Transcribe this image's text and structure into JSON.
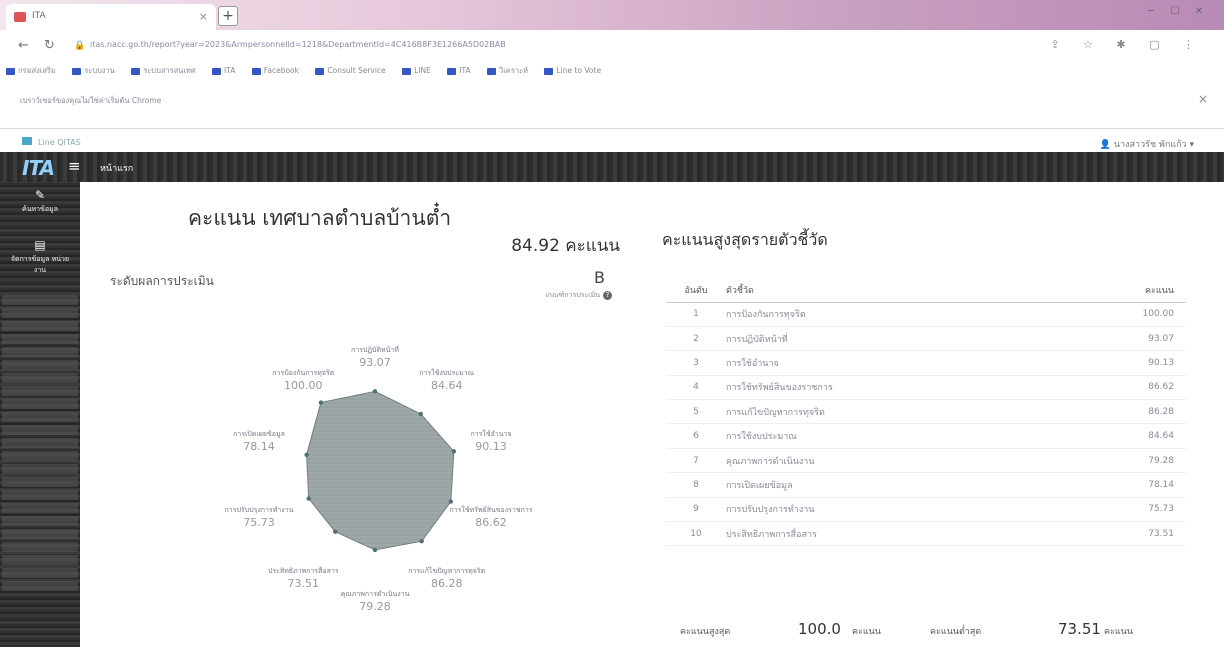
{
  "browser": {
    "tab_title": "ITA",
    "tab_close": "×",
    "new_tab": "+",
    "url": "itas.nacc.go.th/report?year=2023&ArmpersonnelId=1218&DepartmentId=4C416B8F3E1266A5D02BAB",
    "bookmarks": [
      "กรมส่งเสริม",
      "ระบบงาน",
      "ระบบสารสนเทศ",
      "ITA",
      "Facebook",
      "Consult Service",
      "LINE",
      "ITA",
      "วิเคราะห์",
      "Line to Vote"
    ],
    "notice": "เบราว์เซอร์ของคุณไม่ใช่ค่าเริ่มต้น Chrome",
    "notice_close": "×",
    "line_tab": "Line QITAS",
    "user": "นางสาวรัช พักแก้ว ▾"
  },
  "nav": {
    "logo": "ITA",
    "menu_icon": "≡",
    "home": "หน้าแรก"
  },
  "sidebar": {
    "items": [
      {
        "label": "ค้นหาข้อมูล",
        "icon": "✎"
      },
      {
        "label": "จัดการข้อมูล หน่วยงาน",
        "icon": "▤"
      }
    ]
  },
  "summary": {
    "title": "คะแนน เทศบาลตำบลบ้านต๋ำ",
    "score": "84.92 คะแนน",
    "level_label": "ระดับผลการประเมิน",
    "level": "B",
    "level_help": "เกณฑ์การประเมิน",
    "help_icon": "?"
  },
  "radar": [
    {
      "name": "การปฏิบัติหน้าที่",
      "value": 93.07
    },
    {
      "name": "การใช้งบประมาณ",
      "value": 84.64
    },
    {
      "name": "การใช้อำนาจ",
      "value": 90.13
    },
    {
      "name": "การใช้ทรัพย์สินของราชการ",
      "value": 86.62
    },
    {
      "name": "การแก้ไขปัญหาการทุจริต",
      "value": 86.28
    },
    {
      "name": "คุณภาพการดำเนินงาน",
      "value": 79.28
    },
    {
      "name": "ประสิทธิภาพการสื่อสาร",
      "value": 73.51
    },
    {
      "name": "การปรับปรุงการทำงาน",
      "value": 75.73
    },
    {
      "name": "การเปิดเผยข้อมูล",
      "value": 78.14
    },
    {
      "name": "การป้องกันการทุจริต",
      "value": 100.0
    }
  ],
  "ranking": {
    "title": "คะแนนสูงสุดรายตัวชี้วัด",
    "headers": [
      "อันดับ",
      "ตัวชี้วัด",
      "คะแนน"
    ],
    "rows": [
      [
        "1",
        "การป้องกันการทุจริต",
        "100.00"
      ],
      [
        "2",
        "การปฏิบัติหน้าที่",
        "93.07"
      ],
      [
        "3",
        "การใช้อำนาจ",
        "90.13"
      ],
      [
        "4",
        "การใช้ทรัพย์สินของราชการ",
        "86.62"
      ],
      [
        "5",
        "การแก้ไขปัญหาการทุจริต",
        "86.28"
      ],
      [
        "6",
        "การใช้งบประมาณ",
        "84.64"
      ],
      [
        "7",
        "คุณภาพการดำเนินงาน",
        "79.28"
      ],
      [
        "8",
        "การเปิดเผยข้อมูล",
        "78.14"
      ],
      [
        "9",
        "การปรับปรุงการทำงาน",
        "75.73"
      ],
      [
        "10",
        "ประสิทธิภาพการสื่อสาร",
        "73.51"
      ]
    ],
    "max_label": "คะแนนสูงสุด",
    "max_value": "100.0",
    "min_label": "คะแนนต่ำสุด",
    "min_value": "73.51",
    "unit": "คะแนน"
  },
  "colors": {
    "radar_fill": "#9aa3a3",
    "radar_stroke": "#6f7a7a"
  }
}
